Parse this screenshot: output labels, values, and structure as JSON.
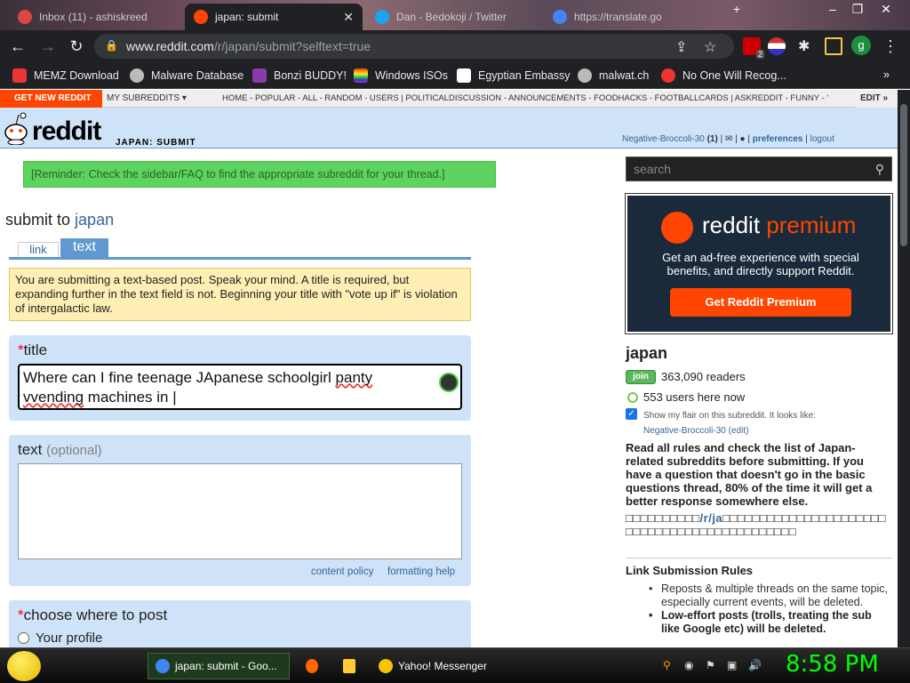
{
  "browser": {
    "tabs": [
      {
        "label": "Inbox (11) - ashiskreed",
        "active": false
      },
      {
        "label": "japan: submit",
        "active": true
      },
      {
        "label": "Dan - Bedokoji / Twitter",
        "active": false
      },
      {
        "label": "https://translate.go",
        "active": false
      }
    ],
    "url_host": "www.reddit.com",
    "url_path": "/r/japan/submit?selftext=true",
    "profile_initial": "g",
    "ext_badge": "2",
    "bookmarks": [
      {
        "label": "MEMZ Download",
        "icon_color": "#e33"
      },
      {
        "label": "Malware Database",
        "icon_color": "#bbb"
      },
      {
        "label": "Bonzi BUDDY!",
        "icon_color": "#8a3aaa"
      },
      {
        "label": "Windows ISOs",
        "icon_color": "#f90"
      },
      {
        "label": "Egyptian Embassy",
        "icon_color": "#fff"
      },
      {
        "label": "malwat.ch",
        "icon_color": "#bbb"
      },
      {
        "label": "No One Will Recog...",
        "icon_color": "#e33"
      }
    ],
    "bookmarks_more": "»"
  },
  "reddit": {
    "get_new": "GET NEW REDDIT",
    "my_subreddits": "MY SUBREDDITS",
    "sr_list": "HOME - POPULAR - ALL - RANDOM - USERS | POLITICALDISCUSSION - ANNOUNCEMENTS - FOODHACKS - FOOTBALLCARDS | ASKREDDIT - FUNNY - '",
    "edit": "EDIT »",
    "logo_word": "reddit",
    "page_name": "JAPAN: SUBMIT",
    "username": "Negative-Broccoli-30",
    "karma": "(1)",
    "preferences": "preferences",
    "logout": "logout",
    "reminder": "[Reminder: Check the sidebar/FAQ to find the appropriate subreddit for your thread.]",
    "submit_to": "submit to",
    "subreddit": "japan",
    "tab_link": "link",
    "tab_text": "text",
    "info": "You are submitting a text-based post. Speak your mind. A title is required, but expanding further in the text field is not. Beginning your title with \"vote up if\" is violation of intergalactic law.",
    "title_label": "title",
    "title_value_1": "Where can I fine teenage JApanese schoolgirl ",
    "title_value_sq1": "panty",
    "title_value_2": "vvending",
    "title_value_3": " machines in |",
    "text_label": "text",
    "text_optional": "(optional)",
    "content_policy": "content policy",
    "formatting_help": "formatting help",
    "choose_label": "choose where to post",
    "your_profile": "Your profile"
  },
  "sidebar": {
    "search_placeholder": "search",
    "premium_word1": "reddit",
    "premium_word2": "premium",
    "premium_desc": "Get an ad-free experience with special benefits, and directly support Reddit.",
    "premium_button": "Get Reddit Premium",
    "sr_title": "japan",
    "join": "join",
    "readers": "363,090 readers",
    "online": "553 users here now",
    "flair_text": "Show my flair on this subreddit. It looks like:",
    "flair_user": "Negative-Broccoli-30",
    "flair_edit": "(edit)",
    "description": "Read all rules and check the list of Japan-related subreddits before submitting. If you have a question that doesn't go in the basic questions thread, 80% of the time it will get a better response somewhere else.",
    "boxes_pre": "□□□□□□□□□□",
    "boxes_sr": "/r/ja",
    "boxes_post": "□□□□□□□□□□□□□□□□□□□□□□□□□□□□□□□□□□□□□□□□□□□□□",
    "rules_title": "Link Submission Rules",
    "rule1": "Reposts & multiple threads on the same topic, especially current events, will be deleted.",
    "rule2": "Low-effort posts (trolls, treating the sub like Google etc) will be deleted."
  },
  "taskbar": {
    "items": [
      {
        "label": "japan: submit - Goo...",
        "icon_color": "#4285f4"
      },
      {
        "label": "Yahoo! Messenger",
        "icon_color": "#f5c400"
      }
    ],
    "clock": "8:58 PM"
  }
}
